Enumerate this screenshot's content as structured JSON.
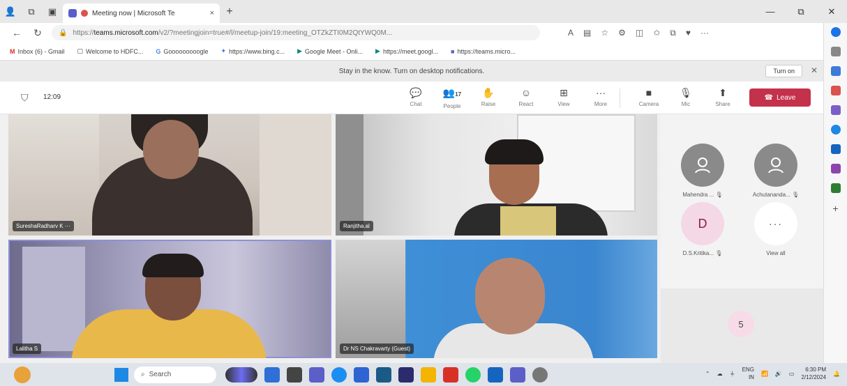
{
  "browser": {
    "tab_title": "Meeting now | Microsoft Te",
    "tab_close": "×",
    "new_tab": "+",
    "window_controls": [
      "—",
      "⧉",
      "✕"
    ],
    "url_prefix": "https://",
    "url_host": "teams.microsoft.com",
    "url_rest": "/v2/?meetingjoin=true#/l/meetup-join/19:meeting_OTZkZTI0M2QtYWQ0M...",
    "bookmarks": [
      {
        "icon": "M",
        "label": "Inbox (6) - Gmail"
      },
      {
        "icon": "▢",
        "label": "Welcome to HDFC..."
      },
      {
        "icon": "G",
        "label": "Gooooooooogle"
      },
      {
        "icon": "✦",
        "label": "https://www.bing.c..."
      },
      {
        "icon": "▶",
        "label": "Google Meet - Onli..."
      },
      {
        "icon": "▶",
        "label": "https://meet.googl..."
      },
      {
        "icon": "■",
        "label": "https://teams.micro..."
      }
    ]
  },
  "notification": {
    "text": "Stay in the know. Turn on desktop notifications.",
    "button": "Turn on",
    "close": "✕"
  },
  "meeting": {
    "timer": "12:09",
    "controls": [
      {
        "label": "Chat",
        "icon": "💬"
      },
      {
        "label": "People",
        "icon": "👥",
        "count": "17"
      },
      {
        "label": "Raise",
        "icon": "✋"
      },
      {
        "label": "React",
        "icon": "☺"
      },
      {
        "label": "View",
        "icon": "⊞"
      },
      {
        "label": "More",
        "icon": "···"
      },
      {
        "label": "Camera",
        "icon": "■"
      },
      {
        "label": "Mic",
        "icon": "🎙"
      },
      {
        "label": "Share",
        "icon": "⬆"
      }
    ],
    "leave_label": "Leave"
  },
  "videos": [
    {
      "name": "SureshaRadharv K",
      "more": "···"
    },
    {
      "name": "Ranjitha.al"
    },
    {
      "name": "Lalitha S"
    },
    {
      "name": "Dr NS Chakravarty (Guest)"
    }
  ],
  "roster": [
    {
      "initial": "",
      "name": "Mahendra ..."
    },
    {
      "initial": "",
      "name": "Achutananda..."
    },
    {
      "initial": "D",
      "name": "D.S.Kritika..."
    },
    {
      "initial": "···",
      "name": "View all"
    }
  ],
  "overflow_count": "5",
  "taskbar": {
    "search_placeholder": "Search",
    "lang": "ENG",
    "lang2": "IN",
    "time": "6:30 PM",
    "date": "2/12/2024"
  }
}
